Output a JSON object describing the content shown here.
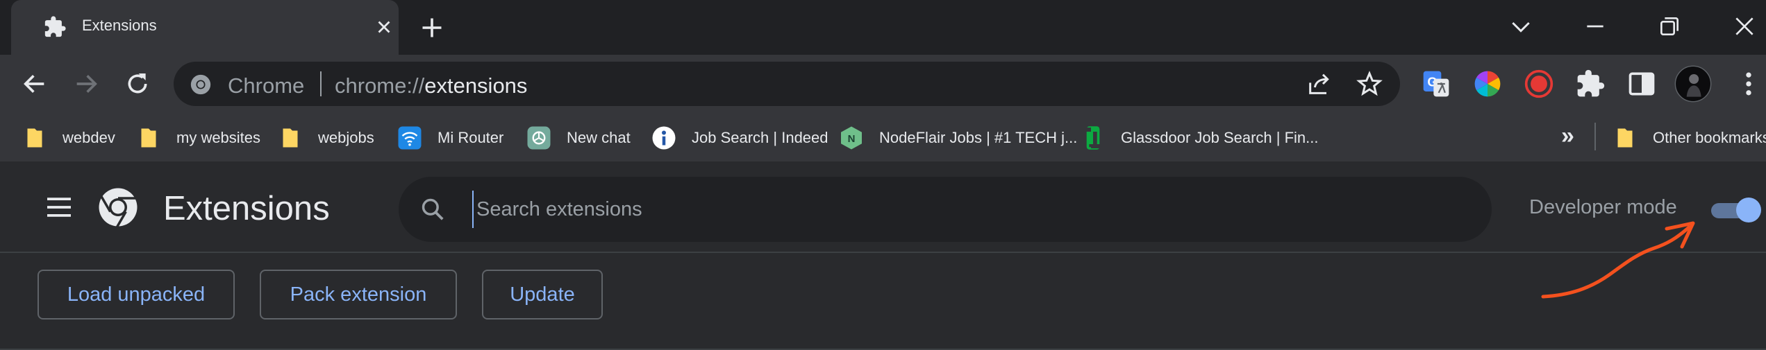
{
  "tab": {
    "title": "Extensions"
  },
  "omnibox": {
    "site_name": "Chrome",
    "url_scheme": "chrome://",
    "url_host": "extensions"
  },
  "bookmarks": [
    {
      "label": "webdev",
      "icon": "folder-icon"
    },
    {
      "label": "my websites",
      "icon": "folder-icon"
    },
    {
      "label": "webjobs",
      "icon": "folder-icon"
    },
    {
      "label": "Mi Router",
      "icon": "wifi-icon"
    },
    {
      "label": "New chat",
      "icon": "openai-icon"
    },
    {
      "label": "Job Search | Indeed",
      "icon": "indeed-icon"
    },
    {
      "label": "NodeFlair Jobs | #1 TECH j...",
      "icon": "nodeflair-icon"
    },
    {
      "label": "Glassdoor Job Search | Fin...",
      "icon": "glassdoor-icon"
    }
  ],
  "other_bookmarks": "Other bookmarks",
  "extensions_page": {
    "title": "Extensions",
    "search_placeholder": "Search extensions",
    "developer_mode_label": "Developer mode",
    "developer_mode_on": true,
    "buttons": {
      "load_unpacked": "Load unpacked",
      "pack_extension": "Pack extension",
      "update": "Update"
    }
  },
  "colors": {
    "accent": "#8ab4f8",
    "annotation": "#f4511e",
    "background": "#292a2d"
  }
}
